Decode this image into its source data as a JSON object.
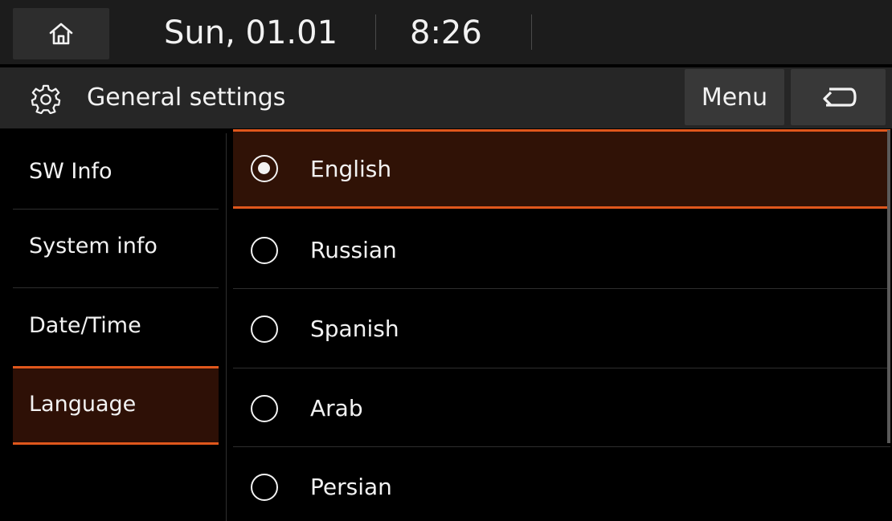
{
  "status": {
    "date": "Sun, 01.01",
    "time": "8:26"
  },
  "header": {
    "title": "General settings",
    "menu_label": "Menu"
  },
  "sidebar": {
    "items": [
      {
        "label": "SW Info"
      },
      {
        "label": "System info"
      },
      {
        "label": "Date/Time"
      },
      {
        "label": "Language"
      }
    ],
    "active_index": 3
  },
  "languages": {
    "options": [
      {
        "label": "English",
        "selected": true
      },
      {
        "label": "Russian",
        "selected": false
      },
      {
        "label": "Spanish",
        "selected": false
      },
      {
        "label": "Arab",
        "selected": false
      },
      {
        "label": "Persian",
        "selected": false
      }
    ]
  },
  "icons": {
    "home": "home-icon",
    "settings": "gear-icon",
    "back": "back-arrow-icon"
  },
  "colors": {
    "accent": "#e0571c",
    "selected_bg": "#301206"
  }
}
